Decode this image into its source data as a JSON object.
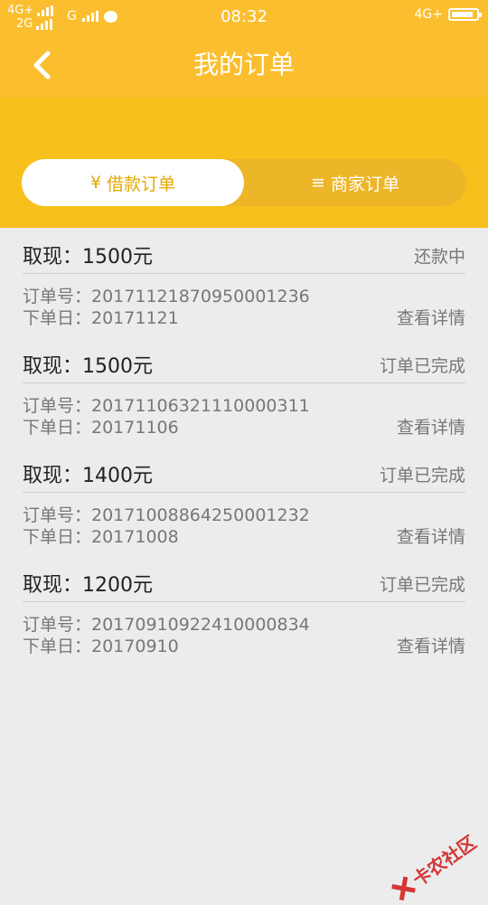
{
  "statusbar": {
    "net_top": "4G+",
    "net_bottom": "2G",
    "net_g": "G",
    "time": "08:32",
    "net_right": "4G+",
    "battery_level": 0.9
  },
  "navbar": {
    "title": "我的订单",
    "back_icon": "chevron-left-icon"
  },
  "tabs": [
    {
      "icon": "¥",
      "label": "借款订单",
      "active": true
    },
    {
      "icon": "≡",
      "label": "商家订单",
      "active": false
    }
  ],
  "orders": [
    {
      "title": "取现：1500元",
      "status": "还款中",
      "order_no": "订单号：20171121870950001236",
      "date": "下单日：20171121",
      "link": "查看详情"
    },
    {
      "title": "取现：1500元",
      "status": "订单已完成",
      "order_no": "订单号：20171106321110000311",
      "date": "下单日：20171106",
      "link": "查看详情"
    },
    {
      "title": "取现：1400元",
      "status": "订单已完成",
      "order_no": "订单号：20171008864250001232",
      "date": "下单日：20171008",
      "link": "查看详情"
    },
    {
      "title": "取现：1200元",
      "status": "订单已完成",
      "order_no": "订单号：20170910922410000834",
      "date": "下单日：20170910",
      "link": "查看详情"
    }
  ],
  "watermark": {
    "text": "卡农社区"
  },
  "colors": {
    "primary": "#fbbe2e",
    "tab_band": "#f8c01c",
    "accent_text": "#e6a800",
    "background": "#ececec"
  }
}
